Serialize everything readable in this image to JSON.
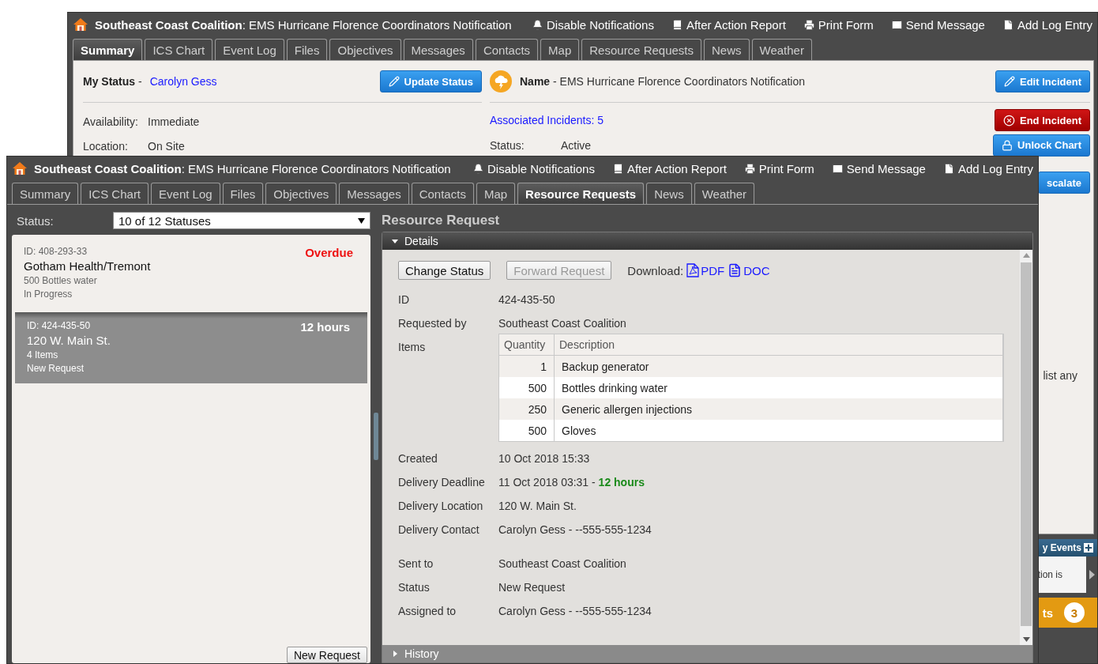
{
  "back_window": {
    "title": "**Southeast Coast Coalition**: EMS Hurricane Florence Coordinators Notification",
    "actions": [
      {
        "kind": "bell",
        "label": "Disable Notifications"
      },
      {
        "kind": "book",
        "label": "After Action Report"
      },
      {
        "kind": "printer",
        "label": "Print Form"
      },
      {
        "kind": "mail",
        "label": "Send Message"
      },
      {
        "kind": "file",
        "label": "Add Log Entry"
      }
    ],
    "tabs": [
      {
        "label": "Summary",
        "selected": true
      },
      {
        "label": "ICS Chart",
        "selected": false
      },
      {
        "label": "Event Log",
        "selected": false
      },
      {
        "label": "Files",
        "selected": false
      },
      {
        "label": "Objectives",
        "selected": false
      },
      {
        "label": "Messages",
        "selected": false
      },
      {
        "label": "Contacts",
        "selected": false
      },
      {
        "label": "Map",
        "selected": false
      },
      {
        "label": "Resource Requests",
        "selected": false
      },
      {
        "label": "News",
        "selected": false
      },
      {
        "label": "Weather",
        "selected": false
      }
    ],
    "my_status": {
      "label": "**My Status** -",
      "name": "Carolyn Gess",
      "button": "Update Status"
    },
    "fields": [
      {
        "label": "Availability:",
        "value": "Immediate"
      },
      {
        "label": "Location:",
        "value": "On Site"
      }
    ],
    "incident": {
      "name": "**Name** - EMS Hurricane Florence Coordinators Notification",
      "edit_button": "Edit Incident",
      "associated": "Associated Incidents: 5",
      "status_label": "Status:",
      "status_value": "Active",
      "end_button": "End Incident",
      "unlock_button": "Unlock Chart",
      "escalate_button": "scalate",
      "note": "list any"
    },
    "events": {
      "title": "y Events",
      "text": "tion is"
    },
    "alerts": {
      "title": "ts",
      "count": "3"
    }
  },
  "front_window": {
    "title": "**Southeast Coast Coalition**: EMS Hurricane Florence Coordinators Notification",
    "actions": [
      {
        "kind": "bell",
        "label": "Disable Notifications"
      },
      {
        "kind": "book",
        "label": "After Action Report"
      },
      {
        "kind": "printer",
        "label": "Print Form"
      },
      {
        "kind": "mail",
        "label": "Send Message"
      },
      {
        "kind": "file",
        "label": "Add Log Entry"
      }
    ],
    "tabs": [
      {
        "label": "Summary",
        "selected": false
      },
      {
        "label": "ICS Chart",
        "selected": false
      },
      {
        "label": "Event Log",
        "selected": false
      },
      {
        "label": "Files",
        "selected": false
      },
      {
        "label": "Objectives",
        "selected": false
      },
      {
        "label": "Messages",
        "selected": false
      },
      {
        "label": "Contacts",
        "selected": false
      },
      {
        "label": "Map",
        "selected": false
      },
      {
        "label": "Resource Requests",
        "selected": true
      },
      {
        "label": "News",
        "selected": false
      },
      {
        "label": "Weather",
        "selected": false
      }
    ],
    "status_filter": {
      "label": "Status:",
      "value": "10 of 12 Statuses"
    },
    "requests": [
      {
        "id": "ID: 408-293-33",
        "due": "Overdue",
        "overdue": true,
        "name": "Gotham Health/Tremont",
        "detail": "500 Bottles water",
        "status": "In Progress",
        "selected": false
      },
      {
        "id": "ID: 424-435-50",
        "due": "12 hours",
        "overdue": false,
        "name": "120 W. Main St.",
        "detail": "4 Items",
        "status": "New Request",
        "selected": true
      }
    ],
    "new_request_button": "New Request",
    "heading": "Resource Request",
    "details": {
      "title": "Details",
      "expanded": true
    },
    "change_status": {
      "label": "Change Status",
      "disabled": false
    },
    "forward_request": {
      "label": "Forward Request",
      "disabled": true
    },
    "download_label": "Download:",
    "downloads": [
      {
        "kind": "pdf",
        "label": "PDF"
      },
      {
        "kind": "doc",
        "label": "DOC"
      }
    ],
    "fields": [
      {
        "label": "ID",
        "value": "424-435-50"
      },
      {
        "label": "Requested by",
        "value": "Southeast Coast Coalition"
      }
    ],
    "items": {
      "label": "Items",
      "columns": [
        "Quantity",
        "Description"
      ],
      "rows": [
        {
          "quantity": "1",
          "description": "Backup generator"
        },
        {
          "quantity": "500",
          "description": "Bottles drinking water"
        },
        {
          "quantity": "250",
          "description": "Generic allergen injections"
        },
        {
          "quantity": "500",
          "description": "Gloves"
        }
      ]
    },
    "fields_after": [
      {
        "label": "Created",
        "value": "10 Oct 2018 15:33"
      },
      {
        "label": "Delivery Deadline",
        "value": "11 Oct 2018 03:31 - **12 hours**"
      },
      {
        "label": "Delivery Location",
        "value": "120 W. Main St."
      },
      {
        "label": "Delivery Contact",
        "value": "Carolyn Gess - --555-555-1234"
      }
    ],
    "routing": [
      {
        "label": "Sent to",
        "value": "Southeast Coast Coalition"
      },
      {
        "label": "Status",
        "value": "New Request"
      },
      {
        "label": "Assigned to",
        "value": "Carolyn Gess - --555-555-1234"
      }
    ],
    "history": {
      "title": "History",
      "expanded": false
    }
  }
}
